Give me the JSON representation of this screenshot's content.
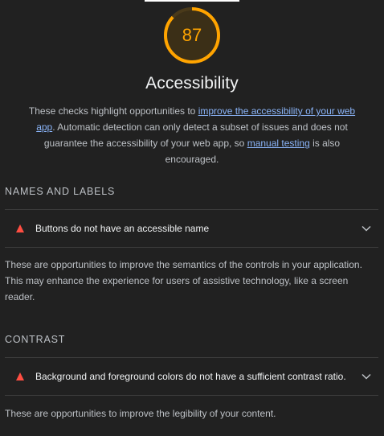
{
  "score": {
    "value": "87",
    "fraction": 0.87,
    "color": "#ffa400"
  },
  "category": {
    "title": "Accessibility",
    "description": {
      "intro": "These checks highlight opportunities to ",
      "link1": "improve the accessibility of your web app",
      "middle": ". Automatic detection can only detect a subset of issues and does not guarantee the accessibility of your web app, so ",
      "link2": "manual testing",
      "outro": " is also encouraged."
    }
  },
  "groups": [
    {
      "title": "NAMES AND LABELS",
      "audit": {
        "status": "fail",
        "status_color": "#ff4e42",
        "title": "Buttons do not have an accessible name"
      },
      "description": "These are opportunities to improve the semantics of the controls in your application. This may enhance the experience for users of assistive technology, like a screen reader."
    },
    {
      "title": "CONTRAST",
      "audit": {
        "status": "fail",
        "status_color": "#ff4e42",
        "title": "Background and foreground colors do not have a sufficient contrast ratio."
      },
      "description": "These are opportunities to improve the legibility of your content."
    }
  ]
}
